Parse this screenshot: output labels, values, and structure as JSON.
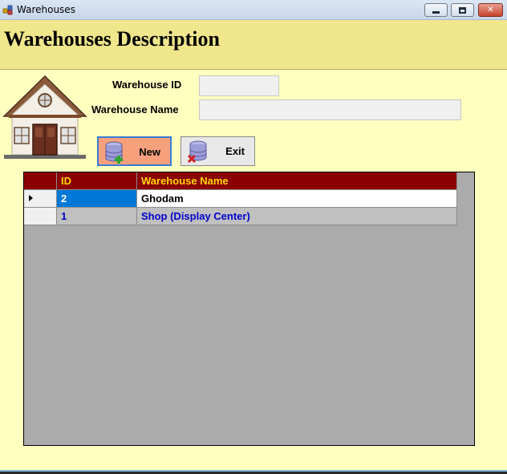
{
  "window": {
    "title": "Warehouses",
    "minimize": "▭",
    "maximize": "□",
    "close": "✕"
  },
  "header": {
    "title": "Warehouses Description"
  },
  "form": {
    "id_label": "Warehouse ID",
    "id_value": "",
    "name_label": "Warehouse Name",
    "name_value": ""
  },
  "toolbar": {
    "new_label": "New",
    "exit_label": "Exit"
  },
  "grid": {
    "columns": [
      "ID",
      "Warehouse Name"
    ],
    "rows": [
      {
        "id": "2",
        "name": "Ghodam"
      },
      {
        "id": "1",
        "name": "Shop (Display Center)"
      }
    ]
  },
  "colors": {
    "background": "#ffffc0",
    "header_band": "#f0e68c",
    "grid_header": "#8b0000",
    "grid_header_text": "#ffd700",
    "selected_cell": "#0078d7",
    "new_button": "#f7a07c"
  }
}
